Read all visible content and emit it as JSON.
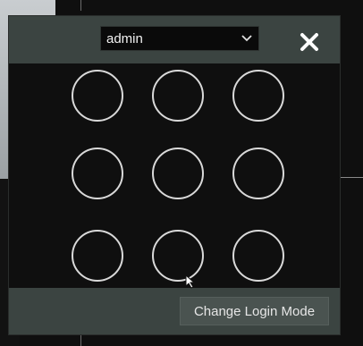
{
  "login": {
    "user_select": {
      "selected": "admin"
    },
    "pattern": {
      "dots": [
        {
          "row": 1,
          "col": 1
        },
        {
          "row": 1,
          "col": 2
        },
        {
          "row": 1,
          "col": 3
        },
        {
          "row": 2,
          "col": 1
        },
        {
          "row": 2,
          "col": 2
        },
        {
          "row": 2,
          "col": 3
        },
        {
          "row": 3,
          "col": 1
        },
        {
          "row": 3,
          "col": 2
        },
        {
          "row": 3,
          "col": 3
        }
      ]
    },
    "footer": {
      "change_mode_label": "Change Login Mode"
    }
  },
  "icons": {
    "close": "close-icon",
    "dropdown": "chevron-down-icon",
    "cursor": "mouse-pointer-icon"
  },
  "colors": {
    "header_bg": "#3b4441",
    "panel_bg": "#0f0f0f",
    "dot_stroke": "#d9d9d9",
    "text": "#f2f2f2"
  }
}
